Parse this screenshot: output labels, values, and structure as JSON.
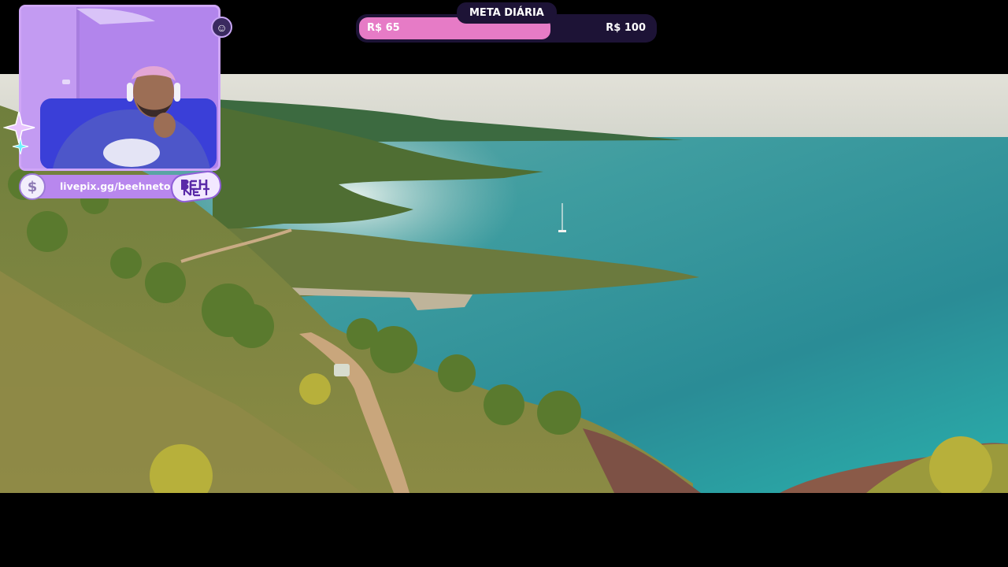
{
  "goal": {
    "title": "META DIÁRIA",
    "current_label": "R$ 65",
    "target_label": "R$ 100",
    "progress_fraction": 0.65,
    "fill_color": "#e67bc6",
    "track_color": "#1d1336"
  },
  "overlay": {
    "livepix_url": "livepix.gg/beehneto",
    "coin_icon": "dollar-coin-icon",
    "emoji_icon": "smiley-badge-icon",
    "logo_text": "Beeh Neto",
    "accent_color": "#c79bf2"
  }
}
